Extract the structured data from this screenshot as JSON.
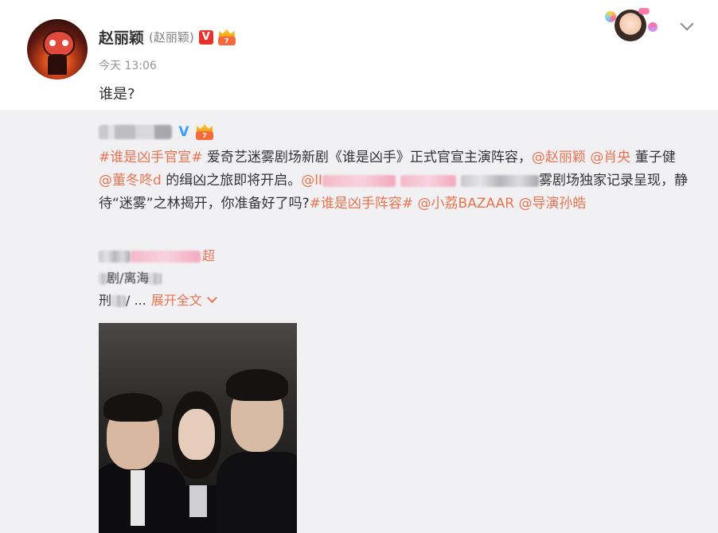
{
  "post": {
    "author_name": "赵丽颖",
    "author_remark": "(赵丽颖)",
    "verified_badge": "V",
    "member_badge": "7",
    "time": "今天 13:06",
    "text": "谁是?"
  },
  "header_icons": {
    "more_menu": "chevron-down-icon"
  },
  "repost": {
    "verified_badge": "V",
    "text_segments": [
      {
        "type": "tag",
        "text": "#谁是凶手官宣#"
      },
      {
        "type": "text",
        "text": " 爱奇艺迷雾剧场新剧《谁是凶手》正式官宣主演阵容，"
      },
      {
        "type": "mention",
        "text": "@赵丽颖"
      },
      {
        "type": "text",
        "text": " "
      },
      {
        "type": "mention",
        "text": "@肖央"
      },
      {
        "type": "text",
        "text": " 董子健 "
      },
      {
        "type": "mention",
        "text": "@董冬咚d"
      },
      {
        "type": "text",
        "text": " 的缉凶之旅即将开启。"
      },
      {
        "type": "mention",
        "text": "@lI"
      },
      {
        "type": "text",
        "text": "雾剧场独家记录呈现，静待“迷雾”之林揭开，你准备好了吗?"
      },
      {
        "type": "tag",
        "text": "#谁是凶手阵容#"
      },
      {
        "type": "text",
        "text": " "
      },
      {
        "type": "mention",
        "text": "@小荔BAZAAR"
      },
      {
        "type": "text",
        "text": " "
      },
      {
        "type": "mention",
        "text": "@导演孙皓"
      }
    ]
  },
  "comment": {
    "line1_suffix": "超",
    "line2_text": "剧/离海",
    "line3_prefix": "刑",
    "line3_suffix": "/ ...",
    "expand_label": "展开全文"
  },
  "colors": {
    "link": "#eb7350",
    "verified_red": "#e8302c",
    "verified_blue": "#3aa0ff",
    "repost_bg": "#f1f1f4"
  }
}
